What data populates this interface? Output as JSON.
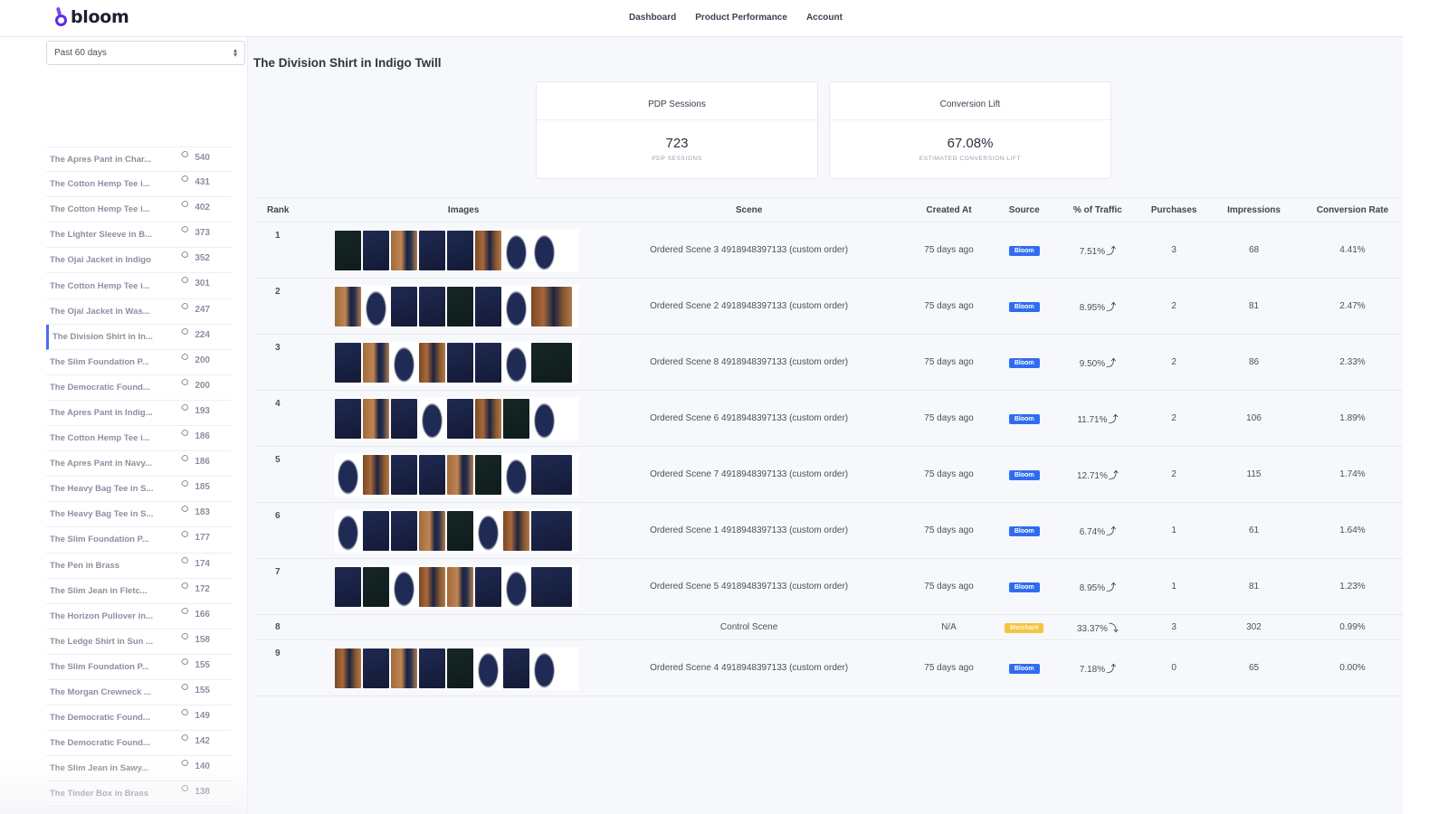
{
  "app": {
    "logo_text": "bloom",
    "nav": [
      "Dashboard",
      "Product Performance",
      "Account"
    ]
  },
  "sidebar": {
    "date_range": "Past 60 days",
    "products": [
      {
        "name": "The Apres Pant in Char...",
        "count": "540"
      },
      {
        "name": "The Cotton Hemp Tee i...",
        "count": "431"
      },
      {
        "name": "The Cotton Hemp Tee i...",
        "count": "402"
      },
      {
        "name": "The Lighter Sleeve in B...",
        "count": "373"
      },
      {
        "name": "The Ojai Jacket in Indigo",
        "count": "352"
      },
      {
        "name": "The Cotton Hemp Tee i...",
        "count": "301"
      },
      {
        "name": "The Ojai Jacket in Was...",
        "count": "247"
      },
      {
        "name": "The Division Shirt in In...",
        "count": "224",
        "active": true
      },
      {
        "name": "The Slim Foundation P...",
        "count": "200"
      },
      {
        "name": "The Democratic Found...",
        "count": "200"
      },
      {
        "name": "The Apres Pant in Indig...",
        "count": "193"
      },
      {
        "name": "The Cotton Hemp Tee i...",
        "count": "186"
      },
      {
        "name": "The Apres Pant in Navy...",
        "count": "186"
      },
      {
        "name": "The Heavy Bag Tee in S...",
        "count": "185"
      },
      {
        "name": "The Heavy Bag Tee in S...",
        "count": "183"
      },
      {
        "name": "The Slim Foundation P...",
        "count": "177"
      },
      {
        "name": "The Pen in Brass",
        "count": "174"
      },
      {
        "name": "The Slim Jean in Fletc...",
        "count": "172"
      },
      {
        "name": "The Horizon Pullover in...",
        "count": "166"
      },
      {
        "name": "The Ledge Shirt in Sun ...",
        "count": "158"
      },
      {
        "name": "The Slim Foundation P...",
        "count": "155"
      },
      {
        "name": "The Morgan Crewneck ...",
        "count": "155"
      },
      {
        "name": "The Democratic Found...",
        "count": "149"
      },
      {
        "name": "The Democratic Found...",
        "count": "142"
      },
      {
        "name": "The Slim Jean in Sawy...",
        "count": "140"
      },
      {
        "name": "The Tinder Box in Brass",
        "count": "138"
      }
    ]
  },
  "main": {
    "title": "The Division Shirt in Indigo Twill",
    "stats": [
      {
        "header": "PDP Sessions",
        "value": "723",
        "caption": "PDP SESSIONS"
      },
      {
        "header": "Conversion Lift",
        "value": "67.08%",
        "caption": "ESTIMATED CONVERSION LIFT"
      }
    ],
    "table": {
      "columns": [
        "Rank",
        "Images",
        "Scene",
        "Created At",
        "Source",
        "% of Traffic",
        "Purchases",
        "Impressions",
        "Conversion Rate"
      ],
      "rows": [
        {
          "rank": "1",
          "images": [
            "dark",
            "flat",
            "door",
            "flat",
            "flat",
            "wood",
            "white",
            "white"
          ],
          "scene": "Ordered Scene 3 4918948397133 (custom order)",
          "created": "75 days ago",
          "source": "Bloom",
          "source_type": "bloom",
          "traffic": "7.51%",
          "trend": "up",
          "purchases": "3",
          "impressions": "68",
          "conversion": "4.41%"
        },
        {
          "rank": "2",
          "images": [
            "door",
            "white",
            "flat",
            "flat",
            "dark",
            "flat",
            "white",
            "wood"
          ],
          "scene": "Ordered Scene 2 4918948397133 (custom order)",
          "created": "75 days ago",
          "source": "Bloom",
          "source_type": "bloom",
          "traffic": "8.95%",
          "trend": "up",
          "purchases": "2",
          "impressions": "81",
          "conversion": "2.47%"
        },
        {
          "rank": "3",
          "images": [
            "flat",
            "door",
            "white",
            "wood",
            "flat",
            "flat",
            "white",
            "dark"
          ],
          "scene": "Ordered Scene 8 4918948397133 (custom order)",
          "created": "75 days ago",
          "source": "Bloom",
          "source_type": "bloom",
          "traffic": "9.50%",
          "trend": "up",
          "purchases": "2",
          "impressions": "86",
          "conversion": "2.33%"
        },
        {
          "rank": "4",
          "images": [
            "flat",
            "door",
            "flat",
            "white",
            "flat",
            "wood",
            "dark",
            "white"
          ],
          "scene": "Ordered Scene 6 4918948397133 (custom order)",
          "created": "75 days ago",
          "source": "Bloom",
          "source_type": "bloom",
          "traffic": "11.71%",
          "trend": "up",
          "purchases": "2",
          "impressions": "106",
          "conversion": "1.89%"
        },
        {
          "rank": "5",
          "images": [
            "white",
            "wood",
            "flat",
            "flat",
            "door",
            "dark",
            "white",
            "flat"
          ],
          "scene": "Ordered Scene 7 4918948397133 (custom order)",
          "created": "75 days ago",
          "source": "Bloom",
          "source_type": "bloom",
          "traffic": "12.71%",
          "trend": "up",
          "purchases": "2",
          "impressions": "115",
          "conversion": "1.74%"
        },
        {
          "rank": "6",
          "images": [
            "white",
            "flat",
            "flat",
            "door",
            "dark",
            "white",
            "wood",
            "flat"
          ],
          "scene": "Ordered Scene 1 4918948397133 (custom order)",
          "created": "75 days ago",
          "source": "Bloom",
          "source_type": "bloom",
          "traffic": "6.74%",
          "trend": "up",
          "purchases": "1",
          "impressions": "61",
          "conversion": "1.64%"
        },
        {
          "rank": "7",
          "images": [
            "flat",
            "dark",
            "white",
            "wood",
            "door",
            "flat",
            "white",
            "flat"
          ],
          "scene": "Ordered Scene 5 4918948397133 (custom order)",
          "created": "75 days ago",
          "source": "Bloom",
          "source_type": "bloom",
          "traffic": "8.95%",
          "trend": "up",
          "purchases": "1",
          "impressions": "81",
          "conversion": "1.23%"
        },
        {
          "rank": "8",
          "images": [],
          "scene": "Control Scene",
          "created": "N/A",
          "source": "Merchant",
          "source_type": "merchant",
          "traffic": "33.37%",
          "trend": "down",
          "purchases": "3",
          "impressions": "302",
          "conversion": "0.99%"
        },
        {
          "rank": "9",
          "images": [
            "wood",
            "flat",
            "door",
            "flat",
            "dark",
            "white",
            "flat",
            "white"
          ],
          "scene": "Ordered Scene 4 4918948397133 (custom order)",
          "created": "75 days ago",
          "source": "Bloom",
          "source_type": "bloom",
          "traffic": "7.18%",
          "trend": "up",
          "purchases": "0",
          "impressions": "65",
          "conversion": "0.00%"
        }
      ]
    }
  }
}
